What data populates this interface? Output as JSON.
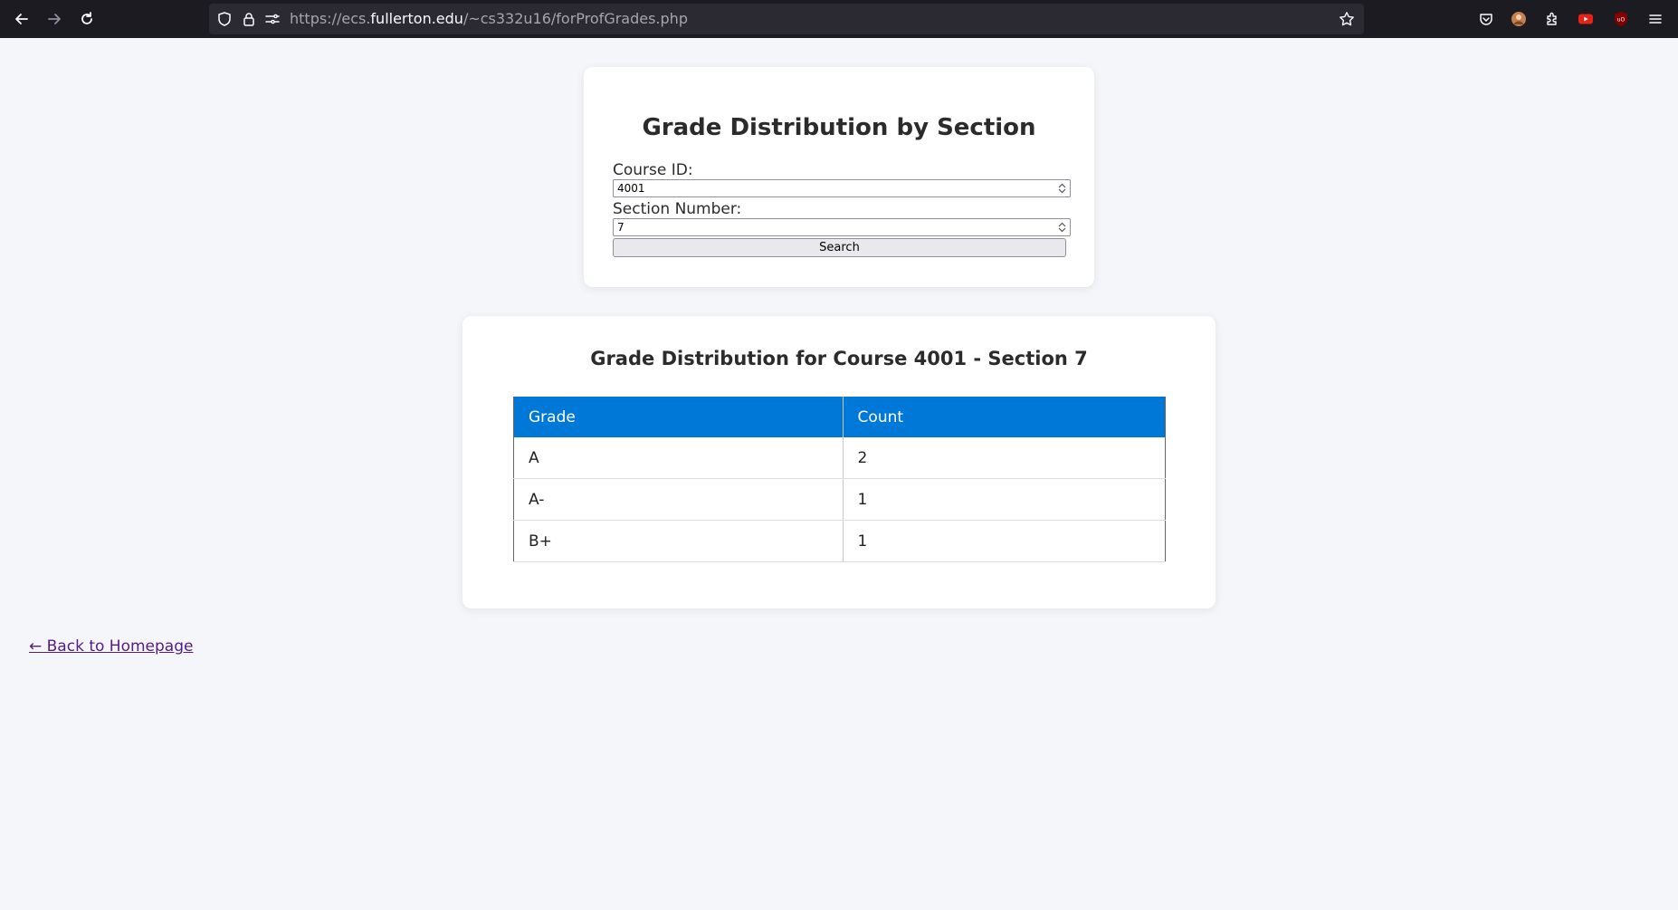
{
  "browser": {
    "url_prefix": "https://ecs.",
    "url_domain": "fullerton.edu",
    "url_path": "/~cs332u16/forProfGrades.php"
  },
  "search_form": {
    "title": "Grade Distribution by Section",
    "course_label": "Course ID:",
    "course_value": "4001",
    "section_label": "Section Number:",
    "section_value": "7",
    "search_button": "Search"
  },
  "results": {
    "title": "Grade Distribution for Course 4001 - Section 7",
    "columns": [
      "Grade",
      "Count"
    ],
    "rows": [
      {
        "grade": "A",
        "count": "2"
      },
      {
        "grade": "A-",
        "count": "1"
      },
      {
        "grade": "B+",
        "count": "1"
      }
    ]
  },
  "back_link": "← Back to Homepage",
  "colors": {
    "header_bg": "#0078d7",
    "link": "#551a8b",
    "page_bg": "#f5f6fa"
  }
}
